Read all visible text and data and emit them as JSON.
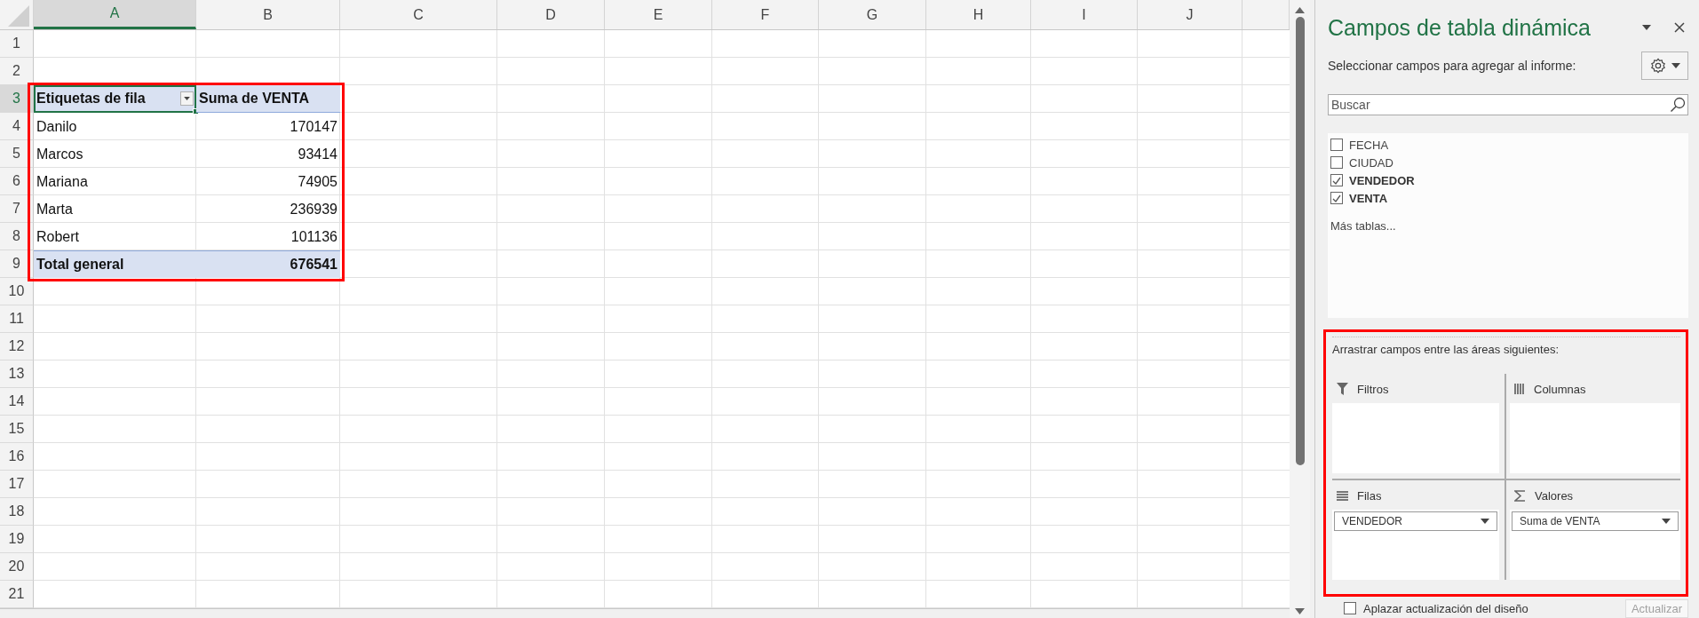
{
  "sheet": {
    "columns": [
      {
        "label": "A",
        "selected": true
      },
      {
        "label": "B",
        "selected": false
      },
      {
        "label": "C",
        "selected": false
      },
      {
        "label": "D",
        "selected": false
      },
      {
        "label": "E",
        "selected": false
      },
      {
        "label": "F",
        "selected": false
      },
      {
        "label": "G",
        "selected": false
      },
      {
        "label": "H",
        "selected": false
      },
      {
        "label": "I",
        "selected": false
      },
      {
        "label": "J",
        "selected": false
      }
    ],
    "rows": [
      {
        "label": "1",
        "selected": false
      },
      {
        "label": "2",
        "selected": false
      },
      {
        "label": "3",
        "selected": true
      },
      {
        "label": "4",
        "selected": false
      },
      {
        "label": "5",
        "selected": false
      },
      {
        "label": "6",
        "selected": false
      },
      {
        "label": "7",
        "selected": false
      },
      {
        "label": "8",
        "selected": false
      },
      {
        "label": "9",
        "selected": false
      },
      {
        "label": "10",
        "selected": false
      },
      {
        "label": "11",
        "selected": false
      },
      {
        "label": "12",
        "selected": false
      },
      {
        "label": "13",
        "selected": false
      },
      {
        "label": "14",
        "selected": false
      },
      {
        "label": "15",
        "selected": false
      },
      {
        "label": "16",
        "selected": false
      },
      {
        "label": "17",
        "selected": false
      },
      {
        "label": "18",
        "selected": false
      },
      {
        "label": "19",
        "selected": false
      },
      {
        "label": "20",
        "selected": false
      },
      {
        "label": "21",
        "selected": false
      }
    ],
    "pivot": {
      "highlighted": true,
      "header": [
        "Etiquetas de fila",
        "Suma de VENTA"
      ],
      "rows": [
        {
          "label": "Danilo",
          "value": "170147"
        },
        {
          "label": "Marcos",
          "value": "93414"
        },
        {
          "label": "Mariana",
          "value": "74905"
        },
        {
          "label": "Marta",
          "value": "236939"
        },
        {
          "label": "Robert",
          "value": "101136"
        }
      ],
      "total": {
        "label": "Total general",
        "value": "676541"
      }
    }
  },
  "pane": {
    "title": "Campos de tabla dinámica",
    "subtitle": "Seleccionar campos para agregar al informe:",
    "search": {
      "placeholder": "Buscar"
    },
    "fields": [
      {
        "label": "FECHA",
        "checked": false
      },
      {
        "label": "CIUDAD",
        "checked": false
      },
      {
        "label": "VENDEDOR",
        "checked": true
      },
      {
        "label": "VENTA",
        "checked": true
      }
    ],
    "more_tables": "Más tablas...",
    "areas_label": "Arrastrar campos entre las áreas siguientes:",
    "areas_highlighted": true,
    "areas": [
      {
        "kind": "filters",
        "title": "Filtros"
      },
      {
        "kind": "columns",
        "title": "Columnas"
      },
      {
        "kind": "rows",
        "title": "Filas",
        "items": [
          "VENDEDOR"
        ]
      },
      {
        "kind": "values",
        "title": "Valores",
        "items": [
          "Suma de VENTA"
        ]
      }
    ],
    "defer": {
      "label": "Aplazar actualización del diseño",
      "checked": false
    },
    "update_button": {
      "label": "Actualizar",
      "disabled": true
    }
  }
}
